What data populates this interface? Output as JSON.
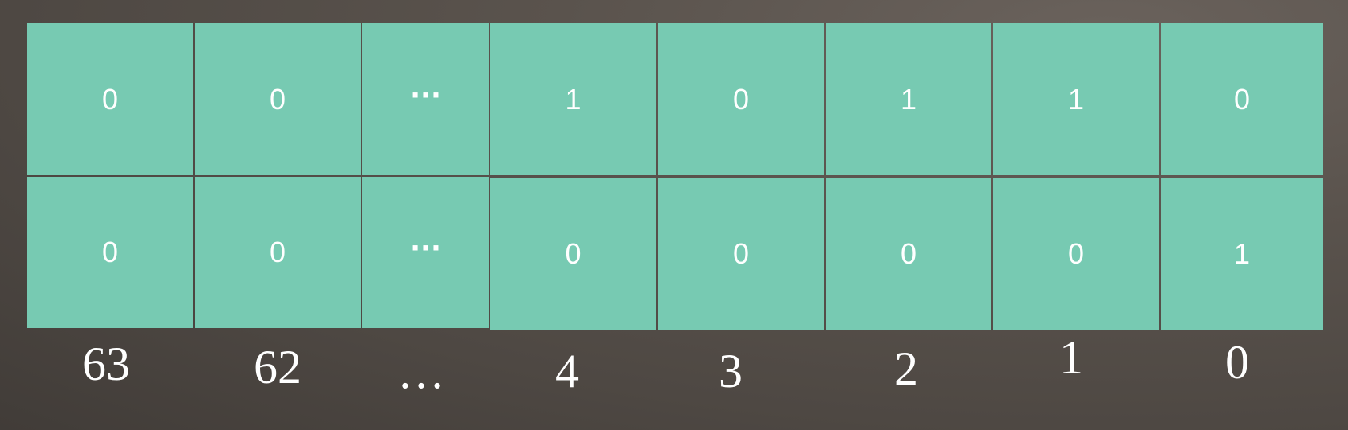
{
  "rows": [
    [
      "0",
      "0",
      "···",
      "1",
      "0",
      "1",
      "1",
      "0"
    ],
    [
      "0",
      "0",
      "···",
      "0",
      "0",
      "0",
      "0",
      "1"
    ]
  ],
  "bit_indices": [
    "63",
    "62",
    "…",
    "4",
    "3",
    "2",
    "1",
    "0"
  ],
  "colors": {
    "cell_fill": "#77cab2",
    "grid_line": "#ffffff",
    "text": "#ffffff"
  }
}
